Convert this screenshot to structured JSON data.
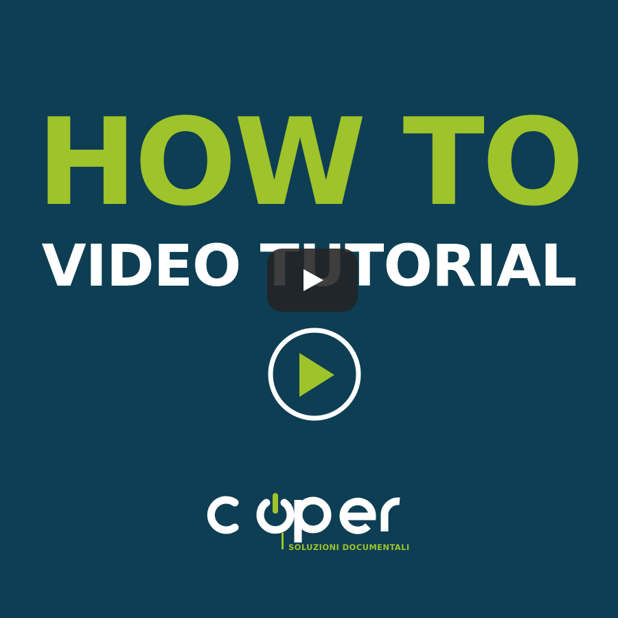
{
  "headline": {
    "top": "HOW TO",
    "bottom": "VIDEO TUTORIAL"
  },
  "player": {
    "play_icon": "youtube-play-icon",
    "secondary_play_icon": "circle-play-icon"
  },
  "brand": {
    "name": "coper",
    "tagline": "SOLUZIONI DOCUMENTALI"
  },
  "colors": {
    "background": "#0d3e53",
    "accent_green": "#9fc32a",
    "white": "#ffffff",
    "player_button": "#232323"
  }
}
